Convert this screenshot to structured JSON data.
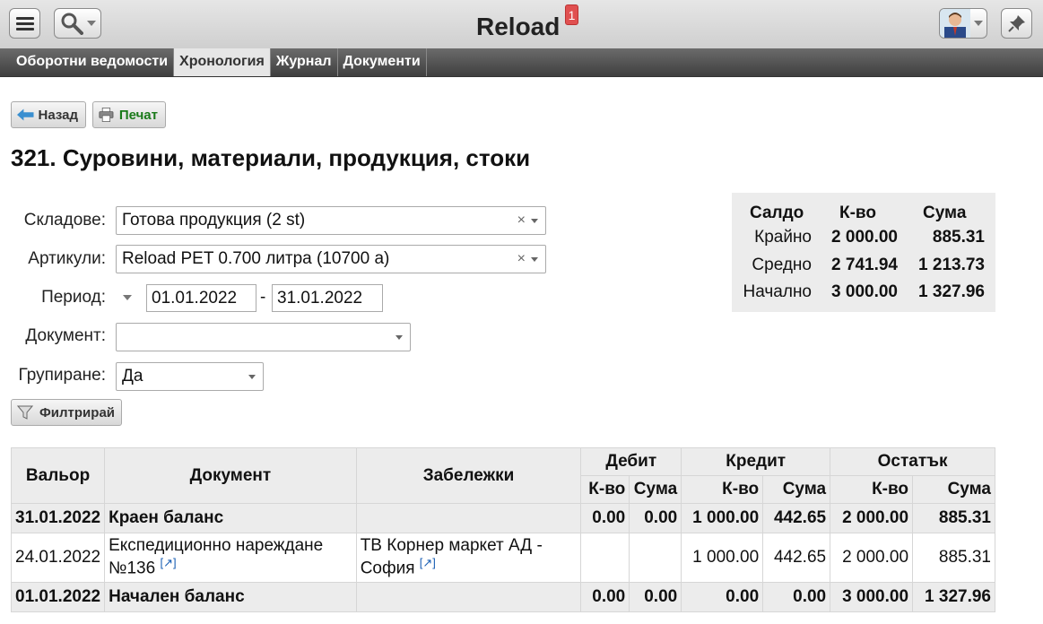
{
  "app": {
    "title": "Reload",
    "notifications": "1"
  },
  "tabs": [
    {
      "label": "Оборотни ведомости",
      "active": false
    },
    {
      "label": "Хронология",
      "active": true
    },
    {
      "label": "Журнал",
      "active": false
    },
    {
      "label": "Документи",
      "active": false
    }
  ],
  "actions": {
    "back_label": "Назад",
    "print_label": "Печат",
    "filter_label": "Филтрирай"
  },
  "page": {
    "title": "321. Суровини, материали, продукция, стоки"
  },
  "filters": {
    "warehouses_label": "Складове:",
    "warehouses_value": "Готова продукция (2 st)",
    "items_label": "Артикули:",
    "items_value": "Reload PET 0.700 литра (10700 a)",
    "period_label": "Период:",
    "period_from": "01.01.2022",
    "period_sep": "-",
    "period_to": "31.01.2022",
    "document_label": "Документ:",
    "document_value": "",
    "grouping_label": "Групиране:",
    "grouping_value": "Да",
    "clear_glyph": "×"
  },
  "summary": {
    "headers": [
      "Салдо",
      "К-во",
      "Сума"
    ],
    "rows": [
      {
        "label": "Крайно",
        "qty": "2 000.00",
        "sum": "885.31"
      },
      {
        "label": "Средно",
        "qty": "2 741.94",
        "sum": "1 213.73"
      },
      {
        "label": "Начално",
        "qty": "3 000.00",
        "sum": "1 327.96"
      }
    ]
  },
  "table": {
    "headers": {
      "date": "Вальор",
      "document": "Документ",
      "notes": "Забележки",
      "debit": "Дебит",
      "credit": "Кредит",
      "balance": "Остатък",
      "qty": "К-во",
      "sum": "Сума"
    },
    "ext_glyph": "[↗]",
    "rows": [
      {
        "date": "31.01.2022",
        "document": "Краен баланс",
        "notes": "",
        "d_qty": "0.00",
        "d_sum": "0.00",
        "c_qty": "1 000.00",
        "c_sum": "442.65",
        "b_qty": "2 000.00",
        "b_sum": "885.31"
      },
      {
        "date": "24.01.2022",
        "document": "Експедиционно нареждане №136",
        "notes": "ТВ Корнер маркет АД - София",
        "d_qty": "",
        "d_sum": "",
        "c_qty": "1 000.00",
        "c_sum": "442.65",
        "b_qty": "2 000.00",
        "b_sum": "885.31"
      },
      {
        "date": "01.01.2022",
        "document": "Начален баланс",
        "notes": "",
        "d_qty": "0.00",
        "d_sum": "0.00",
        "c_qty": "0.00",
        "c_sum": "0.00",
        "b_qty": "3 000.00",
        "b_sum": "1 327.96"
      }
    ]
  }
}
